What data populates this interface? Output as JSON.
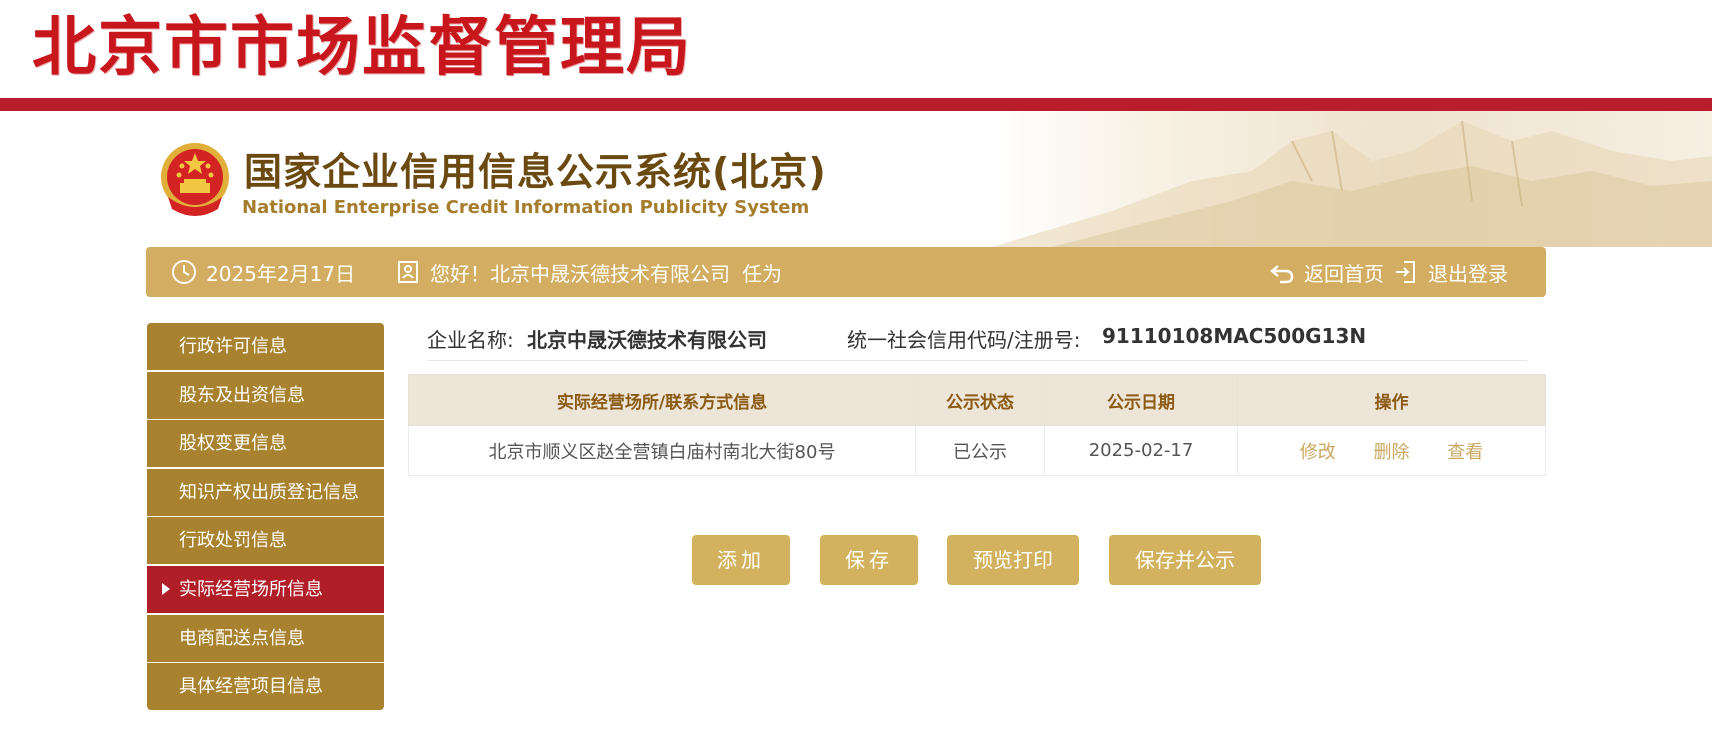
{
  "bureau": {
    "title": "北京市市场监督管理局"
  },
  "system": {
    "title_cn": "国家企业信用信息公示系统(北京)",
    "title_en": "National Enterprise Credit Information Publicity System"
  },
  "infobar": {
    "date": "2025年2月17日",
    "greeting": "您好！北京中晟沃德技术有限公司",
    "role": "任为",
    "home_label": "返回首页",
    "logout_label": "退出登录"
  },
  "sidebar": {
    "items": [
      {
        "label": "行政许可信息"
      },
      {
        "label": "股东及出资信息"
      },
      {
        "label": "股权变更信息"
      },
      {
        "label": "知识产权出质登记信息"
      },
      {
        "label": "行政处罚信息"
      },
      {
        "label": "实际经营场所信息"
      },
      {
        "label": "电商配送点信息"
      },
      {
        "label": "具体经营项目信息"
      }
    ],
    "active_index": 5
  },
  "company": {
    "name_label": "企业名称:",
    "name": "北京中晟沃德技术有限公司",
    "code_label": "统一社会信用代码/注册号:",
    "code": "91110108MAC500G13N"
  },
  "table": {
    "headers": [
      "实际经营场所/联系方式信息",
      "公示状态",
      "公示日期",
      "操作"
    ],
    "rows": [
      {
        "address": "北京市顺义区赵全营镇白庙村南北大街80号",
        "status": "已公示",
        "date": "2025-02-17",
        "ops": [
          "修改",
          "删除",
          "查看"
        ]
      }
    ]
  },
  "buttons": {
    "add": "添加",
    "save": "保存",
    "preview": "预览打印",
    "publish": "保存并公示"
  },
  "colors": {
    "bureau_red": "#c8161d",
    "bar_red": "#b91c2a",
    "gold_bar": "#d2ad62",
    "sidebar_gold": "#a8822e",
    "sidebar_active": "#b01e27",
    "button_gold": "#d2b25e",
    "link_gold": "#c9a861"
  }
}
